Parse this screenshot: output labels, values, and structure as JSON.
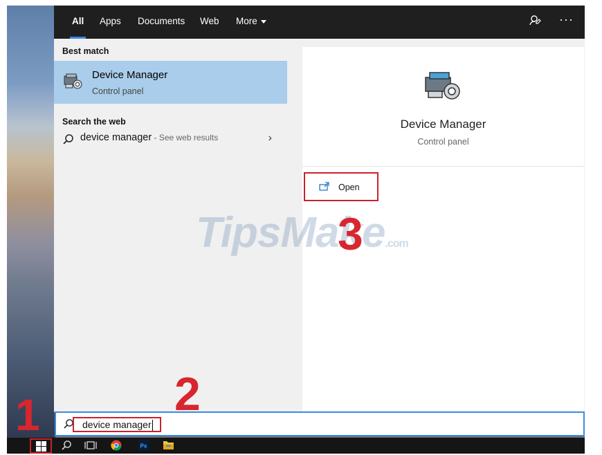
{
  "topbar": {
    "tabs": [
      {
        "label": "All",
        "active": true
      },
      {
        "label": "Apps"
      },
      {
        "label": "Documents"
      },
      {
        "label": "Web"
      },
      {
        "label": "More"
      }
    ],
    "icons": [
      "feedback-icon",
      "more-options-icon"
    ],
    "more_glyph": "···"
  },
  "left": {
    "best_match_heading": "Best match",
    "best_match": {
      "title": "Device Manager",
      "subtitle": "Control panel",
      "icon": "device-manager-icon"
    },
    "web_heading": "Search the web",
    "web_result": {
      "query": "device manager",
      "suffix": " - See web results",
      "chevron": "›"
    }
  },
  "right": {
    "title": "Device Manager",
    "subtitle": "Control panel",
    "open_label": "Open"
  },
  "search": {
    "value": "device manager"
  },
  "annotations": {
    "step1": "1",
    "step2": "2",
    "step3": "3"
  },
  "watermark": {
    "main": "TipsMake",
    "domain": ".com"
  },
  "colors": {
    "accent": "#3b8ae0",
    "highlight": "#a9cdea",
    "annotation_red": "#c8222a",
    "topbar": "#1f1f1f"
  }
}
